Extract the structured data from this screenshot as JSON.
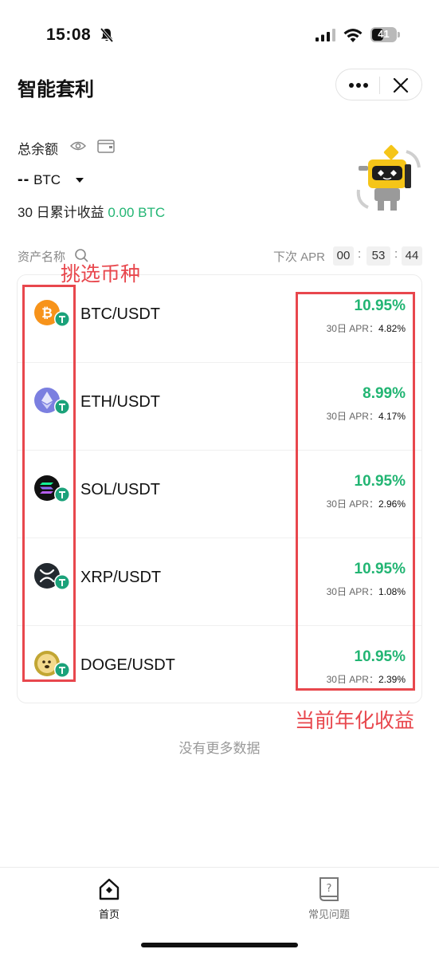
{
  "status_bar": {
    "time": "15:08",
    "battery": "41"
  },
  "header": {
    "title": "智能套利"
  },
  "balance": {
    "label": "总余额",
    "value_dashes": "--",
    "currency": "BTC",
    "profit_label": "30 日累计收益 ",
    "profit_value": "0.00 BTC"
  },
  "list_header": {
    "name_label": "资产名称",
    "next_apr_label": "下次 APR",
    "countdown": [
      "00",
      "53",
      "44"
    ]
  },
  "assets": [
    {
      "pair": "BTC/USDT",
      "apr": "10.95%",
      "apr30_label": "30日 APR：",
      "apr30": "4.82%",
      "icon": "btc-icon"
    },
    {
      "pair": "ETH/USDT",
      "apr": "8.99%",
      "apr30_label": "30日 APR：",
      "apr30": "4.17%",
      "icon": "eth-icon"
    },
    {
      "pair": "SOL/USDT",
      "apr": "10.95%",
      "apr30_label": "30日 APR：",
      "apr30": "2.96%",
      "icon": "sol-icon"
    },
    {
      "pair": "XRP/USDT",
      "apr": "10.95%",
      "apr30_label": "30日 APR：",
      "apr30": "1.08%",
      "icon": "xrp-icon"
    },
    {
      "pair": "DOGE/USDT",
      "apr": "10.95%",
      "apr30_label": "30日 APR：",
      "apr30": "2.39%",
      "icon": "doge-icon"
    }
  ],
  "annotations": {
    "left": "挑选币种",
    "right": "当前年化收益"
  },
  "no_more": "没有更多数据",
  "tabs": [
    {
      "label": "首页",
      "icon": "home-icon",
      "active": true
    },
    {
      "label": "常见问题",
      "icon": "faq-icon",
      "active": false
    }
  ],
  "colors": {
    "green": "#22b573",
    "annotation": "#e8474d"
  }
}
